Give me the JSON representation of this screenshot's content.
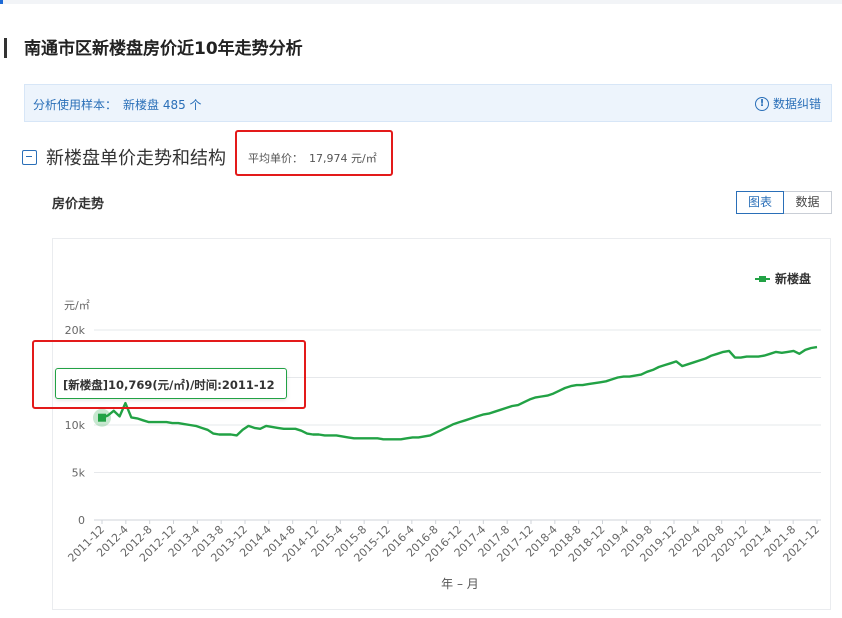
{
  "page": {
    "title": "南通市区新楼盘房价近10年走势分析"
  },
  "info_bar": {
    "sample_label": "分析使用样本：",
    "sample_value": "新楼盘 485 个",
    "correction_label": "数据纠错",
    "correction_icon": "info-circle-icon"
  },
  "section": {
    "title": "新楼盘单价走势和结构",
    "avg_label": "平均单价：",
    "avg_value": "17,974 元/㎡"
  },
  "chart_panel": {
    "label": "房价走势",
    "toggle": {
      "chart": "图表",
      "data": "数据"
    }
  },
  "tooltip": {
    "text": "[新楼盘]10,769(元/㎡)/时间:2011-12"
  },
  "colors": {
    "line": "#22a245",
    "accent": "#2a6fb8",
    "highlight": "#e31a1a"
  },
  "chart_data": {
    "type": "line",
    "ylabel": "元/㎡",
    "xlabel": "年 – 月",
    "ylim": [
      0,
      20000
    ],
    "yticks": [
      0,
      5000,
      10000,
      15000,
      20000
    ],
    "ytick_labels": [
      "0",
      "5k",
      "10k",
      "",
      "20k"
    ],
    "xtick_labels": [
      "2011-12",
      "2012-4",
      "2012-8",
      "2012-12",
      "2013-4",
      "2013-8",
      "2013-12",
      "2014-4",
      "2014-8",
      "2014-12",
      "2015-4",
      "2015-8",
      "2015-12",
      "2016-4",
      "2016-8",
      "2016-12",
      "2017-4",
      "2017-8",
      "2017-12",
      "2018-4",
      "2018-8",
      "2018-12",
      "2019-4",
      "2019-8",
      "2019-12",
      "2020-4",
      "2020-8",
      "2020-12",
      "2021-4",
      "2021-8",
      "2021-12"
    ],
    "legend": "top-right",
    "grid": true,
    "series": [
      {
        "name": "新楼盘",
        "values": [
          10769,
          11000,
          11500,
          10900,
          12300,
          10800,
          10700,
          10500,
          10300,
          10300,
          10300,
          10300,
          10200,
          10200,
          10100,
          10000,
          9900,
          9700,
          9500,
          9100,
          9000,
          9000,
          9000,
          8900,
          9500,
          9900,
          9700,
          9600,
          9900,
          9800,
          9700,
          9600,
          9600,
          9600,
          9400,
          9100,
          9000,
          9000,
          8900,
          8900,
          8900,
          8800,
          8700,
          8600,
          8600,
          8600,
          8600,
          8600,
          8500,
          8500,
          8500,
          8500,
          8600,
          8700,
          8700,
          8800,
          8900,
          9200,
          9500,
          9800,
          10100,
          10300,
          10500,
          10700,
          10900,
          11100,
          11200,
          11400,
          11600,
          11800,
          12000,
          12100,
          12400,
          12700,
          12900,
          13000,
          13100,
          13300,
          13600,
          13900,
          14100,
          14200,
          14200,
          14300,
          14400,
          14500,
          14600,
          14800,
          15000,
          15100,
          15100,
          15200,
          15300,
          15600,
          15800,
          16100,
          16300,
          16500,
          16700,
          16200,
          16400,
          16600,
          16800,
          17000,
          17300,
          17500,
          17700,
          17800,
          17100,
          17100,
          17200,
          17200,
          17200,
          17300,
          17500,
          17700,
          17600,
          17700,
          17800,
          17500,
          17900,
          18100,
          18200
        ]
      }
    ]
  }
}
